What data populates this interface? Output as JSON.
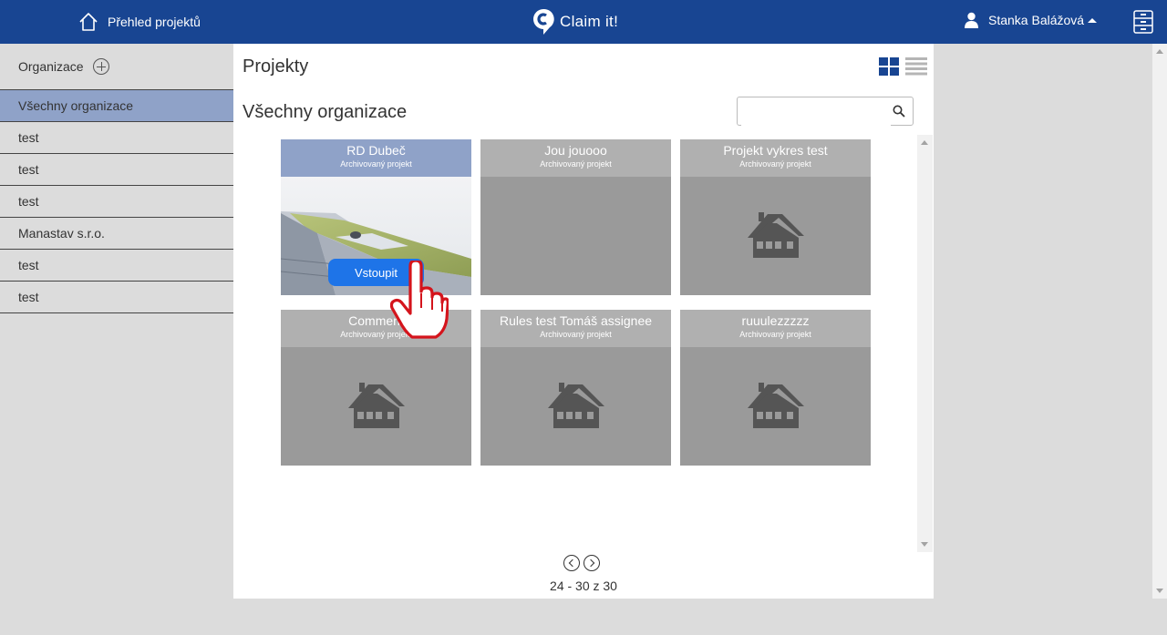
{
  "topbar": {
    "home_label": "Přehled projektů",
    "brand": "Claim it!",
    "user_name": "Stanka Balážová",
    "bg_color": "#184592"
  },
  "sidebar": {
    "heading": "Organizace",
    "items": [
      {
        "label": "Všechny organizace",
        "active": true
      },
      {
        "label": "test"
      },
      {
        "label": "test"
      },
      {
        "label": "test"
      },
      {
        "label": "Manastav s.r.o."
      },
      {
        "label": "test"
      },
      {
        "label": "test"
      }
    ]
  },
  "main": {
    "title": "Projekty",
    "section_title": "Všechny organizace",
    "search_placeholder": "",
    "view_mode": "grid",
    "projects": [
      {
        "title": "RD Dubeč",
        "status": "Archivovaný projekt",
        "has_photo": true,
        "selected": true,
        "action": "Vstoupit"
      },
      {
        "title": "Jou jouooo",
        "status": "Archivovaný projekt",
        "has_photo": false
      },
      {
        "title": "Projekt vykres test",
        "status": "Archivovaný projekt",
        "has_photo": false
      },
      {
        "title": "Comment",
        "status": "Archivovaný projekt",
        "has_photo": false
      },
      {
        "title": "Rules test Tomáš assignee",
        "status": "Archivovaný projekt",
        "has_photo": false
      },
      {
        "title": "ruuulezzzzz",
        "status": "Archivovaný projekt",
        "has_photo": false
      }
    ],
    "pagination": "24 - 30 z 30"
  },
  "icons": {
    "home": "home-icon",
    "brand": "claim-logo-icon",
    "user": "user-icon",
    "cabinet": "file-cabinet-icon",
    "search": "search-icon",
    "house": "house-placeholder-icon",
    "cursor": "hand-pointer-icon"
  }
}
